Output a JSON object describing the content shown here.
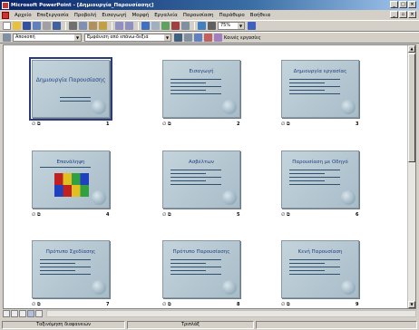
{
  "window": {
    "title": "Microsoft PowerPoint - [Δημιουργία_Παρουσίασης]"
  },
  "menu": [
    "Αρχείο",
    "Επεξεργασία",
    "Προβολή",
    "Εισαγωγή",
    "Μορφή",
    "Εργαλεία",
    "Παρουσίαση",
    "Παράθυρο",
    "Βοήθεια"
  ],
  "toolbar": {
    "zoom": "75%",
    "transition_effect": "Αποκοπή",
    "text_effect": "Εμφάνιση από επάνω-δεξιά",
    "common_tasks": "Κοινές εργασίες"
  },
  "slides": [
    {
      "number": "1",
      "title": "Δημιουργία Παρουσίασης",
      "selected": true,
      "layout": "title"
    },
    {
      "number": "2",
      "title": "Εισαγωγή",
      "selected": false,
      "layout": "bullets"
    },
    {
      "number": "3",
      "title": "Δημιουργία εργασίας",
      "selected": false,
      "layout": "bullets"
    },
    {
      "number": "4",
      "title": "Επανάληψη",
      "selected": false,
      "layout": "puzzle"
    },
    {
      "number": "5",
      "title": "Ασβέλτων",
      "selected": false,
      "layout": "bullets"
    },
    {
      "number": "6",
      "title": "Παρουσίαση με Οδηγό",
      "selected": false,
      "layout": "bullets"
    },
    {
      "number": "7",
      "title": "Πρότυπο Σχεδίασης",
      "selected": false,
      "layout": "bullets"
    },
    {
      "number": "8",
      "title": "Πρότυπο Παρουσίασης",
      "selected": false,
      "layout": "bullets"
    },
    {
      "number": "9",
      "title": "Κενή Παρουσίαση",
      "selected": false,
      "layout": "bullets"
    }
  ],
  "transition_label": "∅ ⧉",
  "status": {
    "view": "Ταξινόμηση διαφανειών",
    "design": "Τριπλάξ"
  }
}
